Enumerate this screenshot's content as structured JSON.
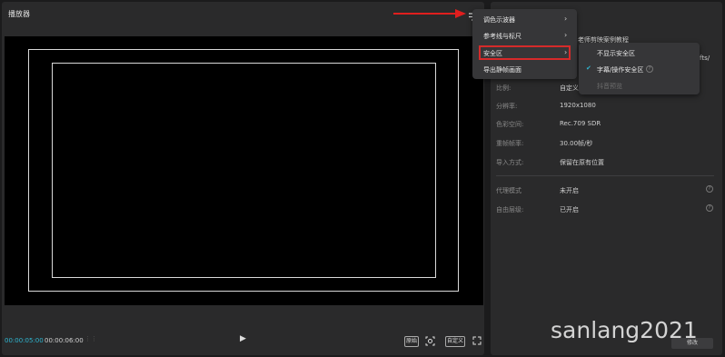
{
  "player": {
    "title": "播放器",
    "time_current": "00:00:05:00",
    "time_total": "00:00:06:00",
    "play_icon": "play-icon",
    "btn_fit": "原始",
    "btn_ratio": "自定义",
    "btn_fullscreen": "fullscreen-icon"
  },
  "details": {
    "project_name_partial": "老师剪映案例教程",
    "path_partial": "fts/",
    "rows": [
      {
        "label": "比例:",
        "value": "自定义"
      },
      {
        "label": "分辨率:",
        "value": "1920x1080"
      },
      {
        "label": "色彩空间:",
        "value": "Rec.709 SDR"
      },
      {
        "label": "重帧帧率:",
        "value": "30.00帧/秒"
      },
      {
        "label": "导入方式:",
        "value": "保留在原有位置"
      },
      {
        "label": "代理模式",
        "value": "未开启"
      },
      {
        "label": "自由层级:",
        "value": "已开启"
      }
    ],
    "edit_button": "修改"
  },
  "menu": {
    "items": [
      "调色示波器",
      "参考线与标尺",
      "安全区",
      "导出静帧画面"
    ],
    "submenu": [
      "不显示安全区",
      "字幕/操作安全区",
      "抖音预览"
    ]
  },
  "watermark": "sanlang2021",
  "colors": {
    "accent": "#2fb6d1",
    "highlight": "#d62a2a"
  }
}
